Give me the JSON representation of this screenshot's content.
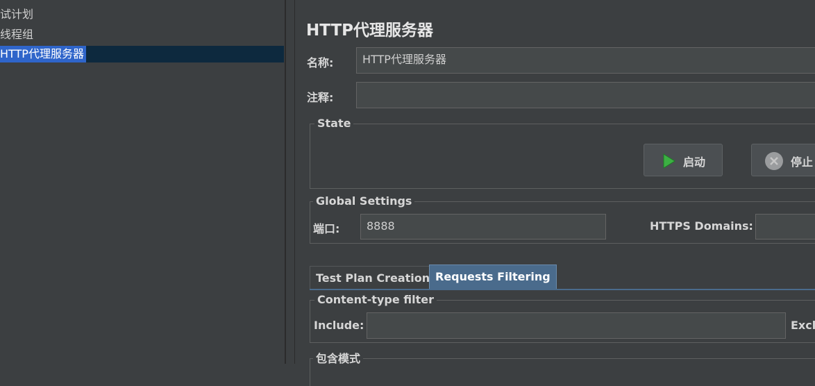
{
  "tree": {
    "items": [
      {
        "label": "试计划"
      },
      {
        "label": "线程组"
      },
      {
        "label": "HTTP代理服务器"
      }
    ]
  },
  "panel": {
    "title": "HTTP代理服务器",
    "name_label": "名称:",
    "name_value": "HTTP代理服务器",
    "comment_label": "注释:",
    "comment_value": ""
  },
  "state": {
    "legend": "State",
    "start_label": "启动",
    "stop_label": "停止"
  },
  "global_settings": {
    "legend": "Global Settings",
    "port_label": "端口:",
    "port_value": "8888",
    "https_label": "HTTPS Domains:",
    "https_value": ""
  },
  "tabs": [
    {
      "label": "Test Plan Creation",
      "active": false
    },
    {
      "label": "Requests Filtering",
      "active": true
    }
  ],
  "content_filter": {
    "legend": "Content-type filter",
    "include_label": "Include:",
    "include_value": "",
    "exclude_label": "Excl"
  },
  "include_patterns": {
    "legend": "包含模式"
  },
  "colors": {
    "background": "#3c3f41",
    "selection": "#2f65ca",
    "start_icon": "#3cb043",
    "active_tab": "#2f65ca"
  },
  "icons": {
    "start": "play-triangle-icon",
    "stop": "stop-circle-icon"
  }
}
